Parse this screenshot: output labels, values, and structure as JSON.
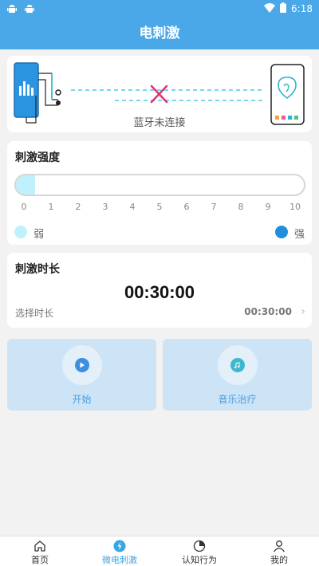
{
  "status_bar": {
    "time": "6:18"
  },
  "header": {
    "title": "电刺激"
  },
  "bluetooth": {
    "status_text": "蓝牙未连接"
  },
  "intensity": {
    "title": "刺激强度",
    "level": 0.5,
    "min": 0,
    "max": 10,
    "ticks": [
      "0",
      "1",
      "2",
      "3",
      "4",
      "5",
      "6",
      "7",
      "8",
      "9",
      "10"
    ],
    "weak_label": "弱",
    "strong_label": "强",
    "weak_color": "#bff0fb",
    "strong_color": "#1f8fdc"
  },
  "duration": {
    "title": "刺激时长",
    "display_time": "00:30:00",
    "select_label": "选择时长",
    "selected_value": "00:30:00"
  },
  "actions": {
    "start_label": "开始",
    "music_label": "音乐治疗"
  },
  "bottom_nav": {
    "items": [
      {
        "label": "首页",
        "icon": "home-icon"
      },
      {
        "label": "微电刺激",
        "icon": "lightning-icon"
      },
      {
        "label": "认知行为",
        "icon": "pie-chart-icon"
      },
      {
        "label": "我的",
        "icon": "user-icon"
      }
    ],
    "active_index": 1
  },
  "colors": {
    "primary": "#4aa8e8",
    "accent": "#3aa4e4"
  }
}
